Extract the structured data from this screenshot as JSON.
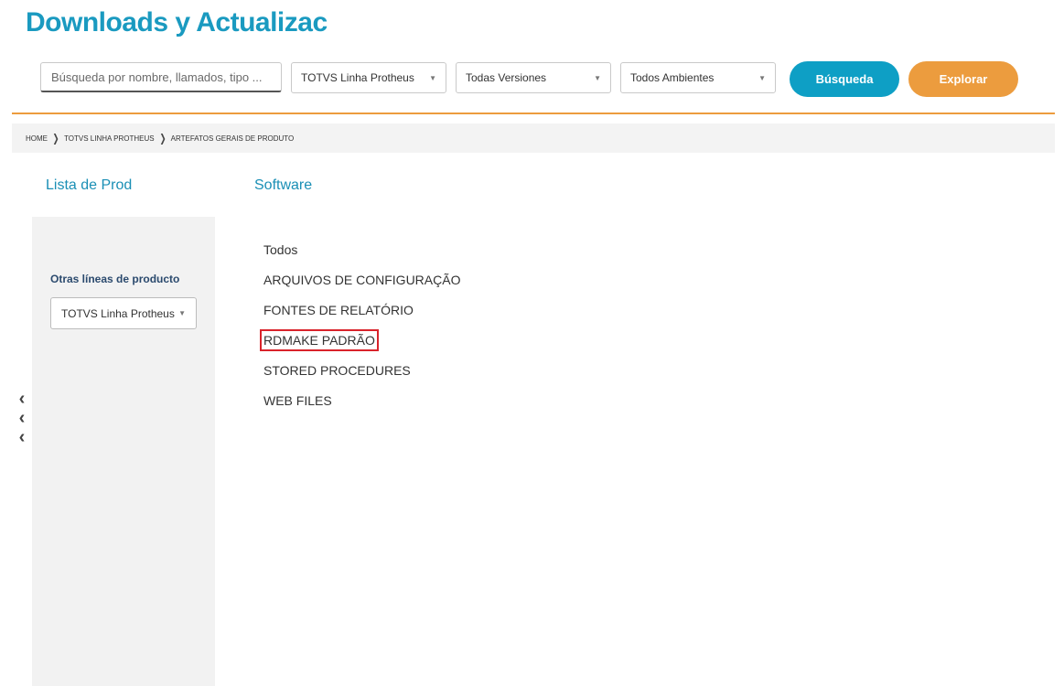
{
  "header": {
    "title": "Downloads y Actualizac"
  },
  "search": {
    "placeholder": "Búsqueda por nombre, llamados, tipo ...",
    "value": ""
  },
  "filters": {
    "product_line": "TOTVS Linha Protheus",
    "versions": "Todas Versiones",
    "environments": "Todos Ambientes",
    "caret": "▼"
  },
  "buttons": {
    "search": "Búsqueda",
    "explore": "Explorar"
  },
  "colors": {
    "brand_blue": "#1a9ac0",
    "search_button": "#0e9fc5",
    "explore_button": "#ec9c3e",
    "highlight_outline": "#d9232b"
  },
  "breadcrumb": {
    "items": [
      "HOME",
      "TOTVS LINHA PROTHEUS",
      "ARTEFATOS GERAIS DE PRODUTO"
    ],
    "separator": "❯"
  },
  "sidebar": {
    "heading": "Lista de Prod",
    "other_lines_label": "Otras líneas de producto",
    "selected_line": "TOTVS Linha Protheus",
    "collapse_icon": "‹"
  },
  "main": {
    "heading": "Software",
    "items": [
      "Todos",
      "ARQUIVOS DE CONFIGURAÇÃO",
      "FONTES DE RELATÓRIO",
      "RDMAKE PADRÃO",
      "STORED PROCEDURES",
      "WEB FILES"
    ],
    "highlighted_item": "RDMAKE PADRÃO"
  }
}
